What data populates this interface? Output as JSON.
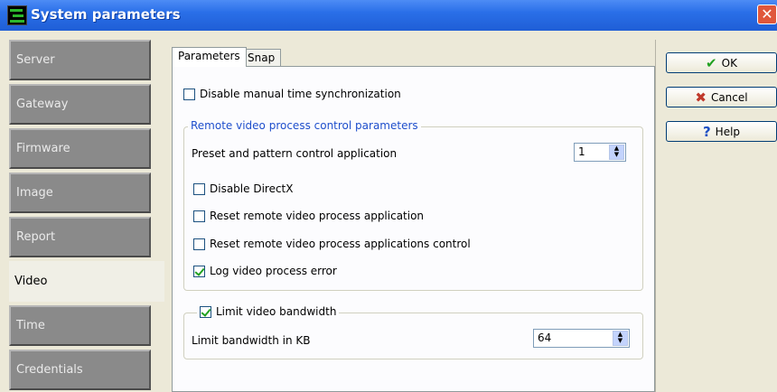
{
  "window": {
    "title": "System parameters",
    "close_glyph": "✕"
  },
  "sidebar": {
    "items": [
      {
        "label": "Server"
      },
      {
        "label": "Gateway"
      },
      {
        "label": "Firmware"
      },
      {
        "label": "Image"
      },
      {
        "label": "Report"
      },
      {
        "label": "Video",
        "active": true
      },
      {
        "label": "Time"
      },
      {
        "label": "Credentials"
      }
    ]
  },
  "tabs": [
    {
      "label": "Parameters"
    },
    {
      "label": "Snap"
    }
  ],
  "params": {
    "disable_manual_sync": {
      "label": "Disable manual time synchronization",
      "checked": false
    },
    "remote_group": {
      "legend": "Remote video process control parameters",
      "preset_label": "Preset and pattern control application",
      "preset_value": "1",
      "disable_directx": {
        "label": "Disable DirectX",
        "checked": false
      },
      "reset_app": {
        "label": "Reset remote video process application",
        "checked": false
      },
      "reset_control": {
        "label": "Reset remote video process applications control",
        "checked": false
      },
      "log_error": {
        "label": "Log video process error",
        "checked": true
      }
    },
    "bandwidth_group": {
      "limit": {
        "label": "Limit video bandwidth",
        "checked": true
      },
      "kb_label": "Limit bandwidth in KB",
      "kb_value": "64"
    }
  },
  "buttons": {
    "ok": {
      "label": "OK",
      "icon": "check-icon"
    },
    "cancel": {
      "label": "Cancel",
      "icon": "x-icon"
    },
    "help": {
      "label": "Help",
      "icon": "question-icon"
    }
  },
  "colors": {
    "title_bar": "#2a6fe8",
    "sidebar_tab": "#8a8a8a",
    "ok_check": "#21a121",
    "cancel_x": "#c0392b",
    "help_q": "#1c4fc4"
  }
}
